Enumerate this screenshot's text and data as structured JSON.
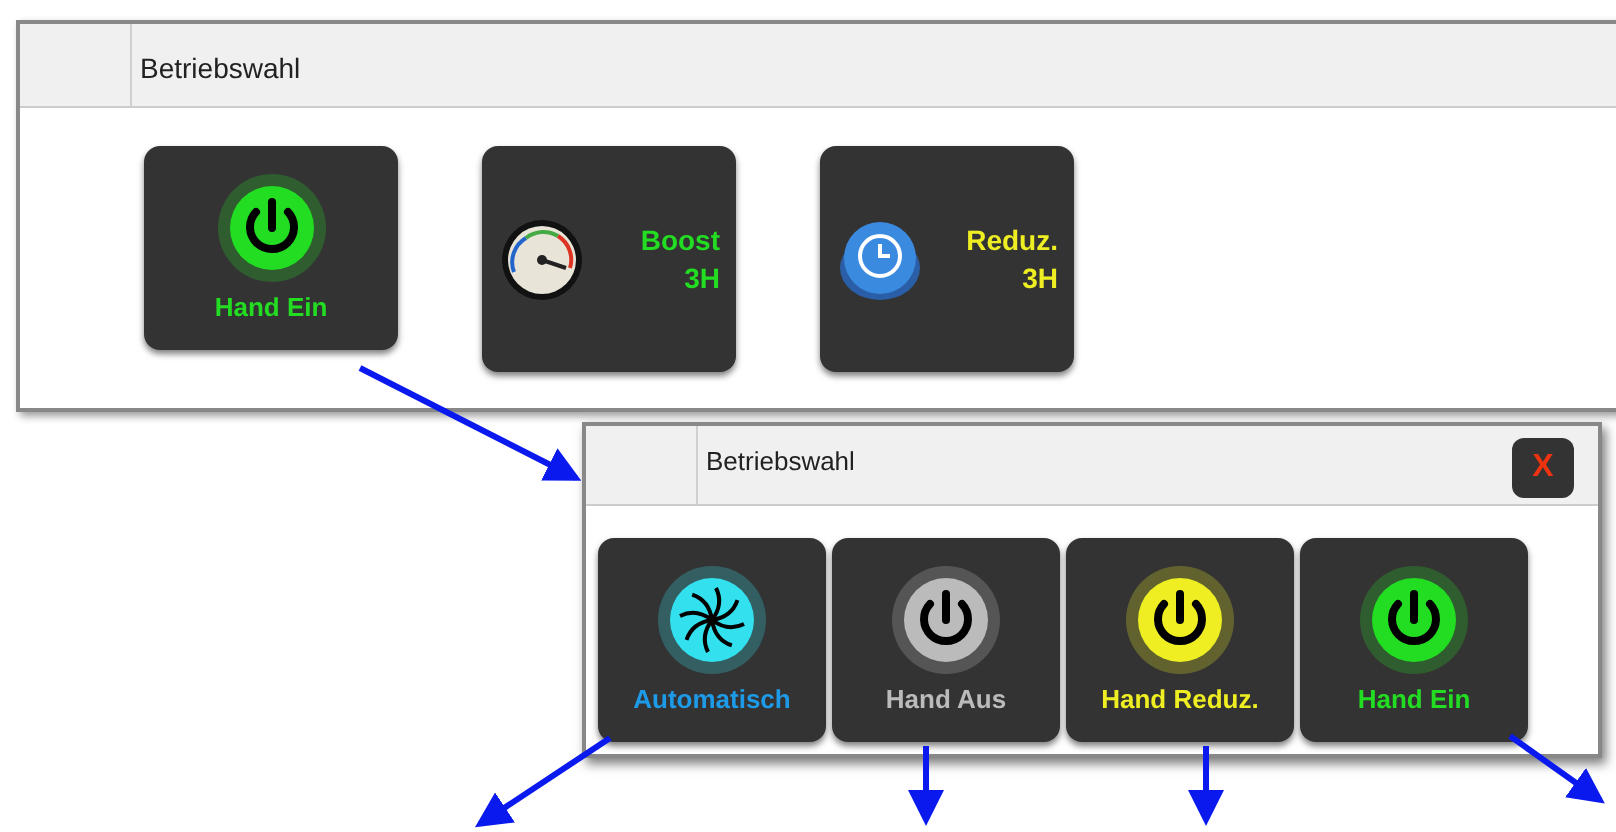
{
  "panels": [
    {
      "title": "Betriebswahl",
      "buttons": [
        {
          "kind": "power",
          "lines": [
            "Hand Ein"
          ],
          "color": "#22dd22"
        },
        {
          "kind": "gauge",
          "lines": [
            "Boost",
            "3H"
          ],
          "color": "#22dd22"
        },
        {
          "kind": "clock",
          "lines": [
            "Reduz.",
            "3H"
          ],
          "color": "#eeee22"
        }
      ]
    },
    {
      "title": "Betriebswahl",
      "close": "X",
      "buttons": [
        {
          "kind": "fan",
          "lines": [
            "Automatisch"
          ],
          "color": "#1e9be8"
        },
        {
          "kind": "power",
          "lines": [
            "Hand Aus"
          ],
          "color": "#bbbbbb"
        },
        {
          "kind": "power",
          "lines": [
            "Hand Reduz."
          ],
          "color": "#eeee22"
        },
        {
          "kind": "power",
          "lines": [
            "Hand Ein"
          ],
          "color": "#22dd22"
        }
      ]
    }
  ]
}
